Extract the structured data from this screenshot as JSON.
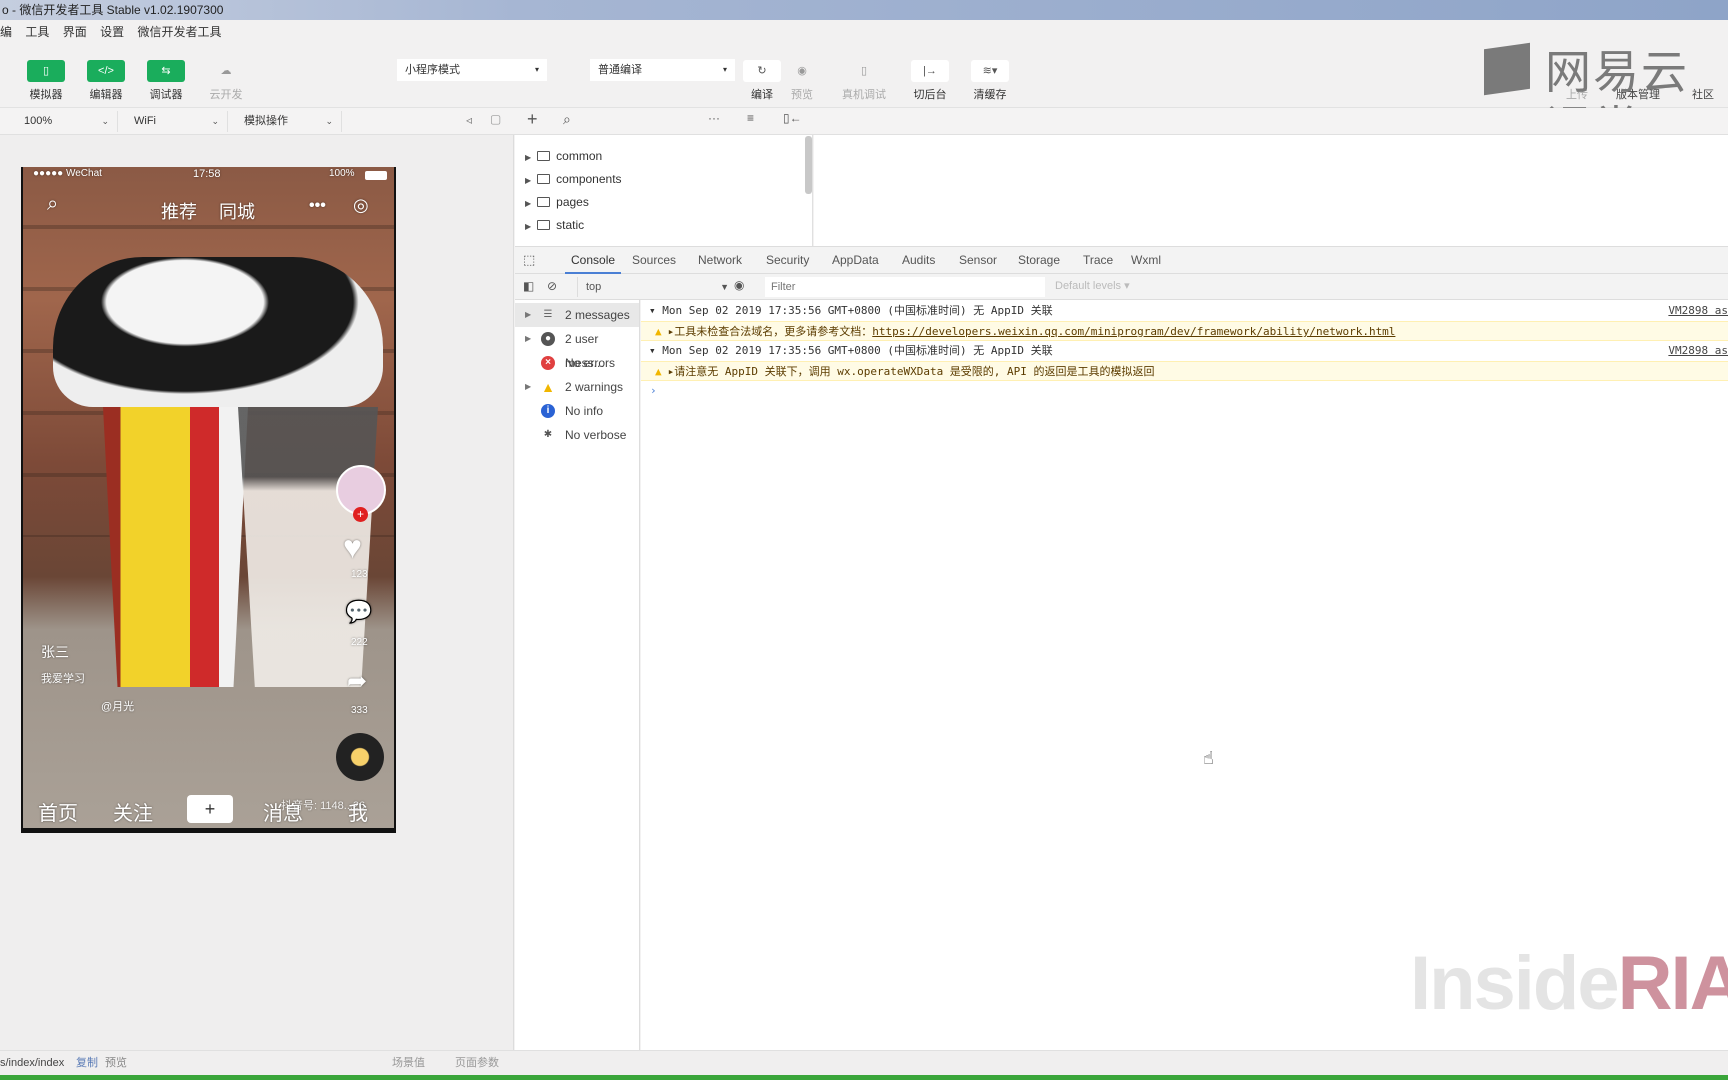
{
  "window": {
    "title": "o - 微信开发者工具 Stable v1.02.1907300"
  },
  "menu": [
    "编",
    "工具",
    "界面",
    "设置",
    "微信开发者工具"
  ],
  "toolbar": {
    "buttons": [
      {
        "label": "模拟器",
        "icon": "phone-icon"
      },
      {
        "label": "编辑器",
        "icon": "code-icon"
      },
      {
        "label": "调试器",
        "icon": "debug-icon"
      },
      {
        "label": "云开发",
        "icon": "cloud-icon"
      }
    ],
    "mode_select": "小程序模式",
    "compile_select": "普通编译",
    "actions": [
      {
        "label": "编译",
        "icon": "refresh-icon"
      },
      {
        "label": "预览",
        "icon": "eye-icon"
      },
      {
        "label": "真机调试",
        "icon": "device-debug-icon"
      },
      {
        "label": "切后台",
        "icon": "switch-icon"
      },
      {
        "label": "清缓存",
        "icon": "layers-icon"
      }
    ],
    "right_actions": [
      "上传",
      "版本管理",
      "社区"
    ]
  },
  "toolbar2": {
    "zoom": "100%",
    "network": "WiFi",
    "sim_ops": "模拟操作"
  },
  "phone": {
    "status": {
      "carrier": "●●●●● WeChat",
      "time": "17:58",
      "battery": "100%"
    },
    "top_tabs": [
      "推荐",
      "同城"
    ],
    "user": "张三",
    "desc": "我爱学习",
    "music": "@月光",
    "likes": "123",
    "comments": "222",
    "shares": "333",
    "watermark": "抖音号: 1148...26",
    "bottom_nav": [
      "首页",
      "关注",
      "+",
      "消息",
      "我"
    ]
  },
  "filetree": [
    {
      "name": "common"
    },
    {
      "name": "components"
    },
    {
      "name": "pages"
    },
    {
      "name": "static"
    }
  ],
  "devtools": {
    "tabs": [
      "Console",
      "Sources",
      "Network",
      "Security",
      "AppData",
      "Audits",
      "Sensor",
      "Storage",
      "Trace",
      "Wxml"
    ],
    "active_tab": "Console",
    "context": "top",
    "filter_placeholder": "Filter",
    "levels": "Default levels ▾",
    "sidebar": [
      {
        "label": "2 messages",
        "icon": "list-icon",
        "color": "#666666"
      },
      {
        "label": "2 user mess...",
        "icon": "user-icon",
        "color": "#555555"
      },
      {
        "label": "No errors",
        "icon": "error-icon",
        "color": "#e04040"
      },
      {
        "label": "2 warnings",
        "icon": "warning-icon",
        "color": "#f1b600"
      },
      {
        "label": "No info",
        "icon": "info-icon",
        "color": "#2a62d4"
      },
      {
        "label": "No verbose",
        "icon": "bug-icon",
        "color": "#555555"
      }
    ],
    "messages": [
      {
        "header": "▾ Mon Sep 02 2019 17:35:56 GMT+0800 (中国标准时间) 无 AppID 关联",
        "source": "VM2898 as",
        "warning": "▸工具未检查合法域名，更多请参考文档：",
        "link": "https://developers.weixin.qq.com/miniprogram/dev/framework/ability/network.html"
      },
      {
        "header": "▾ Mon Sep 02 2019 17:35:56 GMT+0800 (中国标准时间) 无 AppID 关联",
        "source": "VM2898 as",
        "warning": "▸请注意无 AppID 关联下，调用 wx.operateWXData 是受限的, API 的返回是工具的模拟返回",
        "link": ""
      }
    ],
    "prompt": "›"
  },
  "statusbar": {
    "path": "s/index/index",
    "copy": "复制",
    "preview": "预览",
    "scene": "场景值",
    "params": "页面参数"
  },
  "watermarks": {
    "top": "网易云课堂",
    "bottom": "InsideRIA"
  },
  "colors": {
    "accent_green": "#1aad5c",
    "tab_underline": "#4a7fd4",
    "warning_bg": "#fffbe5"
  }
}
